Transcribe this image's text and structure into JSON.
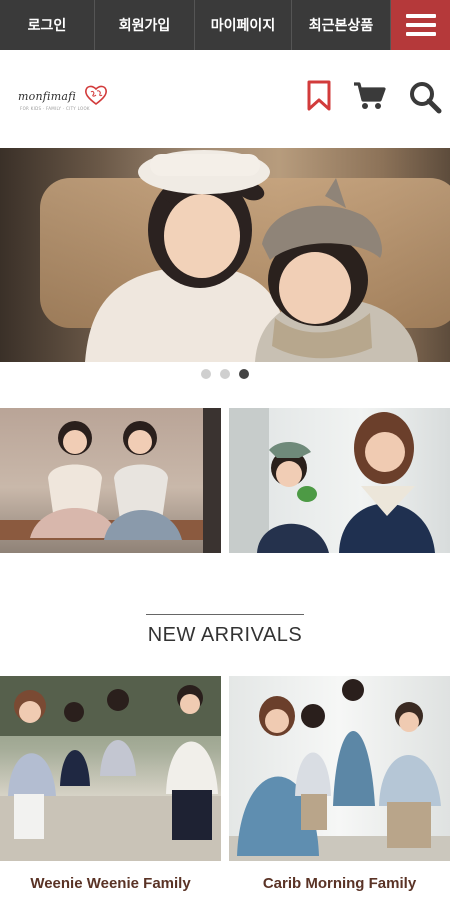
{
  "nav": {
    "items": [
      "로그인",
      "회원가입",
      "마이페이지",
      "최근본상품"
    ],
    "menu_icon": "hamburger-icon",
    "menu_color": "#b5393a"
  },
  "header": {
    "logo_text": "monfimafi",
    "logo_subtext": "FOR KIDS · FAMILY · CITY LOOK",
    "icons": [
      "bookmark-icon",
      "cart-icon",
      "search-icon"
    ],
    "accent_color": "#d23b3b"
  },
  "banner": {
    "slide_count": 3,
    "active_slide": 3
  },
  "section": {
    "title": "NEW ARRIVALS"
  },
  "products": [
    {
      "name": "Weenie Weenie Family"
    },
    {
      "name": "Carib Morning Family"
    }
  ]
}
